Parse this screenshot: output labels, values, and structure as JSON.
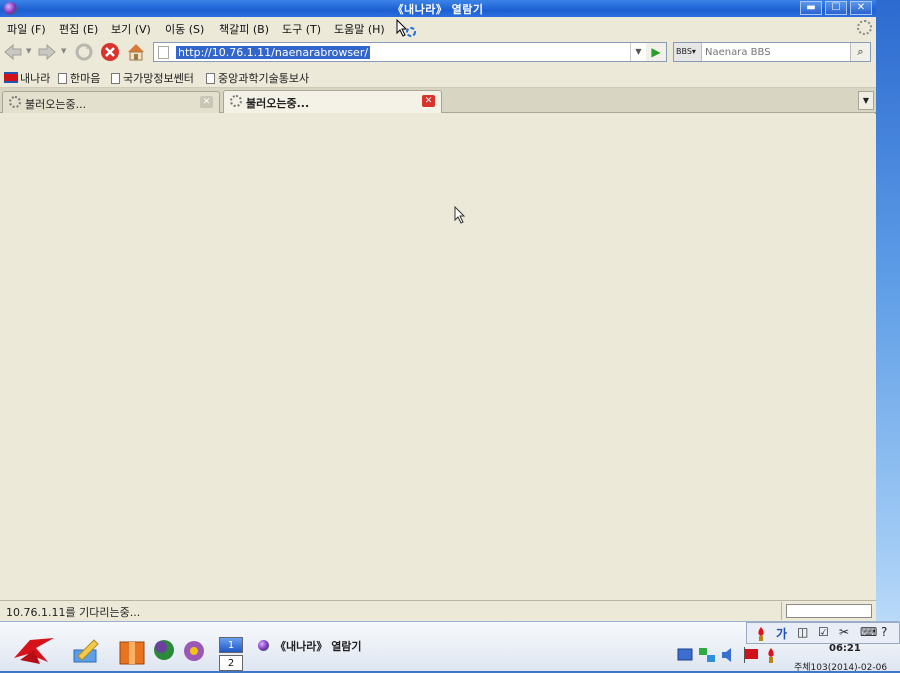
{
  "window": {
    "title": "《내나라》 열람기",
    "buttons": {
      "minimize": "▬",
      "maximize": "☐",
      "close": "✕"
    }
  },
  "menu": [
    "파일 (F)",
    "편집 (E)",
    "보기 (V)",
    "이동 (S)",
    "책갈피 (B)",
    "도구 (T)",
    "도움말 (H)"
  ],
  "navigation": {
    "url": "http://10.76.1.11/naenarabrowser/",
    "search_engine": "BBS",
    "search_placeholder": "Naenara BBS",
    "icons": [
      "back-icon",
      "forward-icon",
      "reload-icon",
      "stop-icon",
      "home-icon"
    ]
  },
  "bookmarks": [
    "내나라",
    "한마음",
    "국가망정보쎈터",
    "중앙과학기술통보사"
  ],
  "tabs": [
    {
      "label": "불러오는중...",
      "active": false
    },
    {
      "label": "불러오는중...",
      "active": true
    }
  ],
  "status": {
    "text": "10.76.1.11를 기다리는중..."
  },
  "taskbar": {
    "workspaces": [
      "1",
      "2"
    ],
    "task_title": "《내나라》 열람기",
    "ime": [
      "가"
    ],
    "clock": "06:21",
    "date": "주체103(2014)-02-06"
  },
  "colors": {
    "titlebar": "#1b5fd1",
    "chrome": "#ece9d8",
    "url_selection": "#3366cc",
    "stop_red": "#d9332e"
  }
}
